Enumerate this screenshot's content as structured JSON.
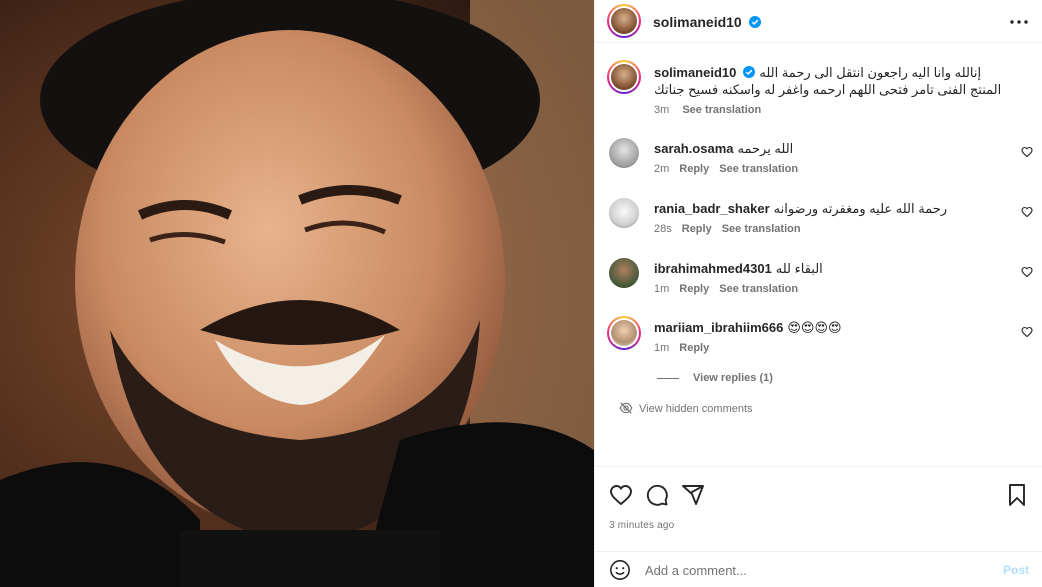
{
  "post": {
    "author": "solimaneid10",
    "caption": "إنالله وانا اليه راجعون انتقل الى رحمة الله المنتج الفنى تامر فتحى اللهم ارحمه واغفر له واسكنه فسيح جناتك",
    "caption_age": "3m",
    "caption_translate": "See translation",
    "time_ago": "3 minutes ago"
  },
  "header": {
    "more_icon": "more-horizontal-icon"
  },
  "comments": [
    {
      "username": "sarah.osama",
      "text": "الله يرحمه",
      "age": "2m",
      "reply": "Reply",
      "translate": "See translation"
    },
    {
      "username": "rania_badr_shaker",
      "text": "رحمة الله عليه ومغفرته ورضوانه",
      "age": "28s",
      "reply": "Reply",
      "translate": "See translation"
    },
    {
      "username": "ibrahimahmed4301",
      "text": "البقاء لله",
      "age": "1m",
      "reply": "Reply",
      "translate": "See translation"
    },
    {
      "username": "mariiam_ibrahiim666",
      "text": "😍😍😍😍",
      "age": "1m",
      "reply": "Reply"
    }
  ],
  "view_replies": "View replies (1)",
  "view_hidden": "View hidden comments",
  "add_comment": {
    "placeholder": "Add a comment...",
    "post_label": "Post"
  },
  "colors": {
    "verified": "#0095f6",
    "muted": "#737373",
    "post_disabled": "#b2dffc"
  }
}
